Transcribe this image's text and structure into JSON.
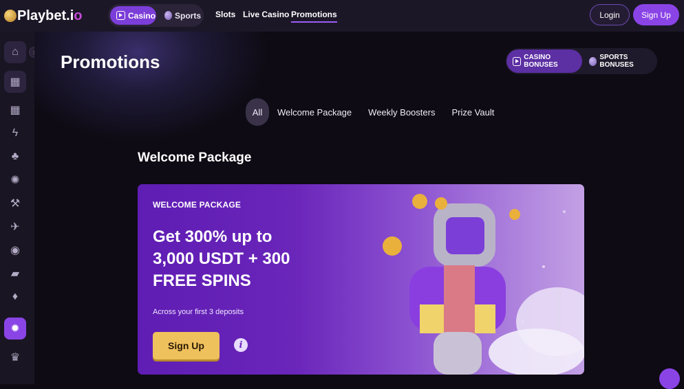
{
  "header": {
    "logo_text": "Playbet.i",
    "logo_suffix": "o",
    "toggle": {
      "casino": "Casino",
      "sports": "Sports"
    },
    "nav": [
      "Slots",
      "Live Casino",
      "Promotions"
    ],
    "login": "Login",
    "signup": "Sign Up"
  },
  "sidebar": {
    "items": [
      {
        "icon": "home-icon",
        "glyph": "⌂"
      },
      {
        "icon": "slot-machine-icon",
        "glyph": "▦"
      },
      {
        "icon": "grid-icon",
        "glyph": "▦"
      },
      {
        "icon": "lightning-icon",
        "glyph": "ϟ"
      },
      {
        "icon": "cherries-icon",
        "glyph": "♣"
      },
      {
        "icon": "roulette-icon",
        "glyph": "✺"
      },
      {
        "icon": "shovels-icon",
        "glyph": "⚒"
      },
      {
        "icon": "plane-icon",
        "glyph": "✈"
      },
      {
        "icon": "live-broadcast-icon",
        "glyph": "◉"
      },
      {
        "icon": "cards-icon",
        "glyph": "▰"
      },
      {
        "icon": "card-icon",
        "glyph": "♦"
      },
      {
        "icon": "promotions-icon",
        "glyph": "✹"
      },
      {
        "icon": "trophy-icon",
        "glyph": "♛"
      }
    ]
  },
  "main": {
    "title": "Promotions",
    "bonus_tabs": {
      "casino": "CASINO BONUSES",
      "sports": "SPORTS BONUSES"
    },
    "filters": [
      "All",
      "Welcome Package",
      "Weekly Boosters",
      "Prize Vault"
    ],
    "section_title": "Welcome Package",
    "banner": {
      "kicker": "WELCOME PACKAGE",
      "headline_1": "Get 300% up to",
      "headline_2": "3,000 USDT + 300",
      "headline_3": "FREE SPINS",
      "sub": "Across your first 3 deposits",
      "cta": "Sign Up",
      "info": "i"
    }
  },
  "colors": {
    "accent": "#8a44e6",
    "cta": "#efc15c",
    "bg": "#0e0b14"
  }
}
